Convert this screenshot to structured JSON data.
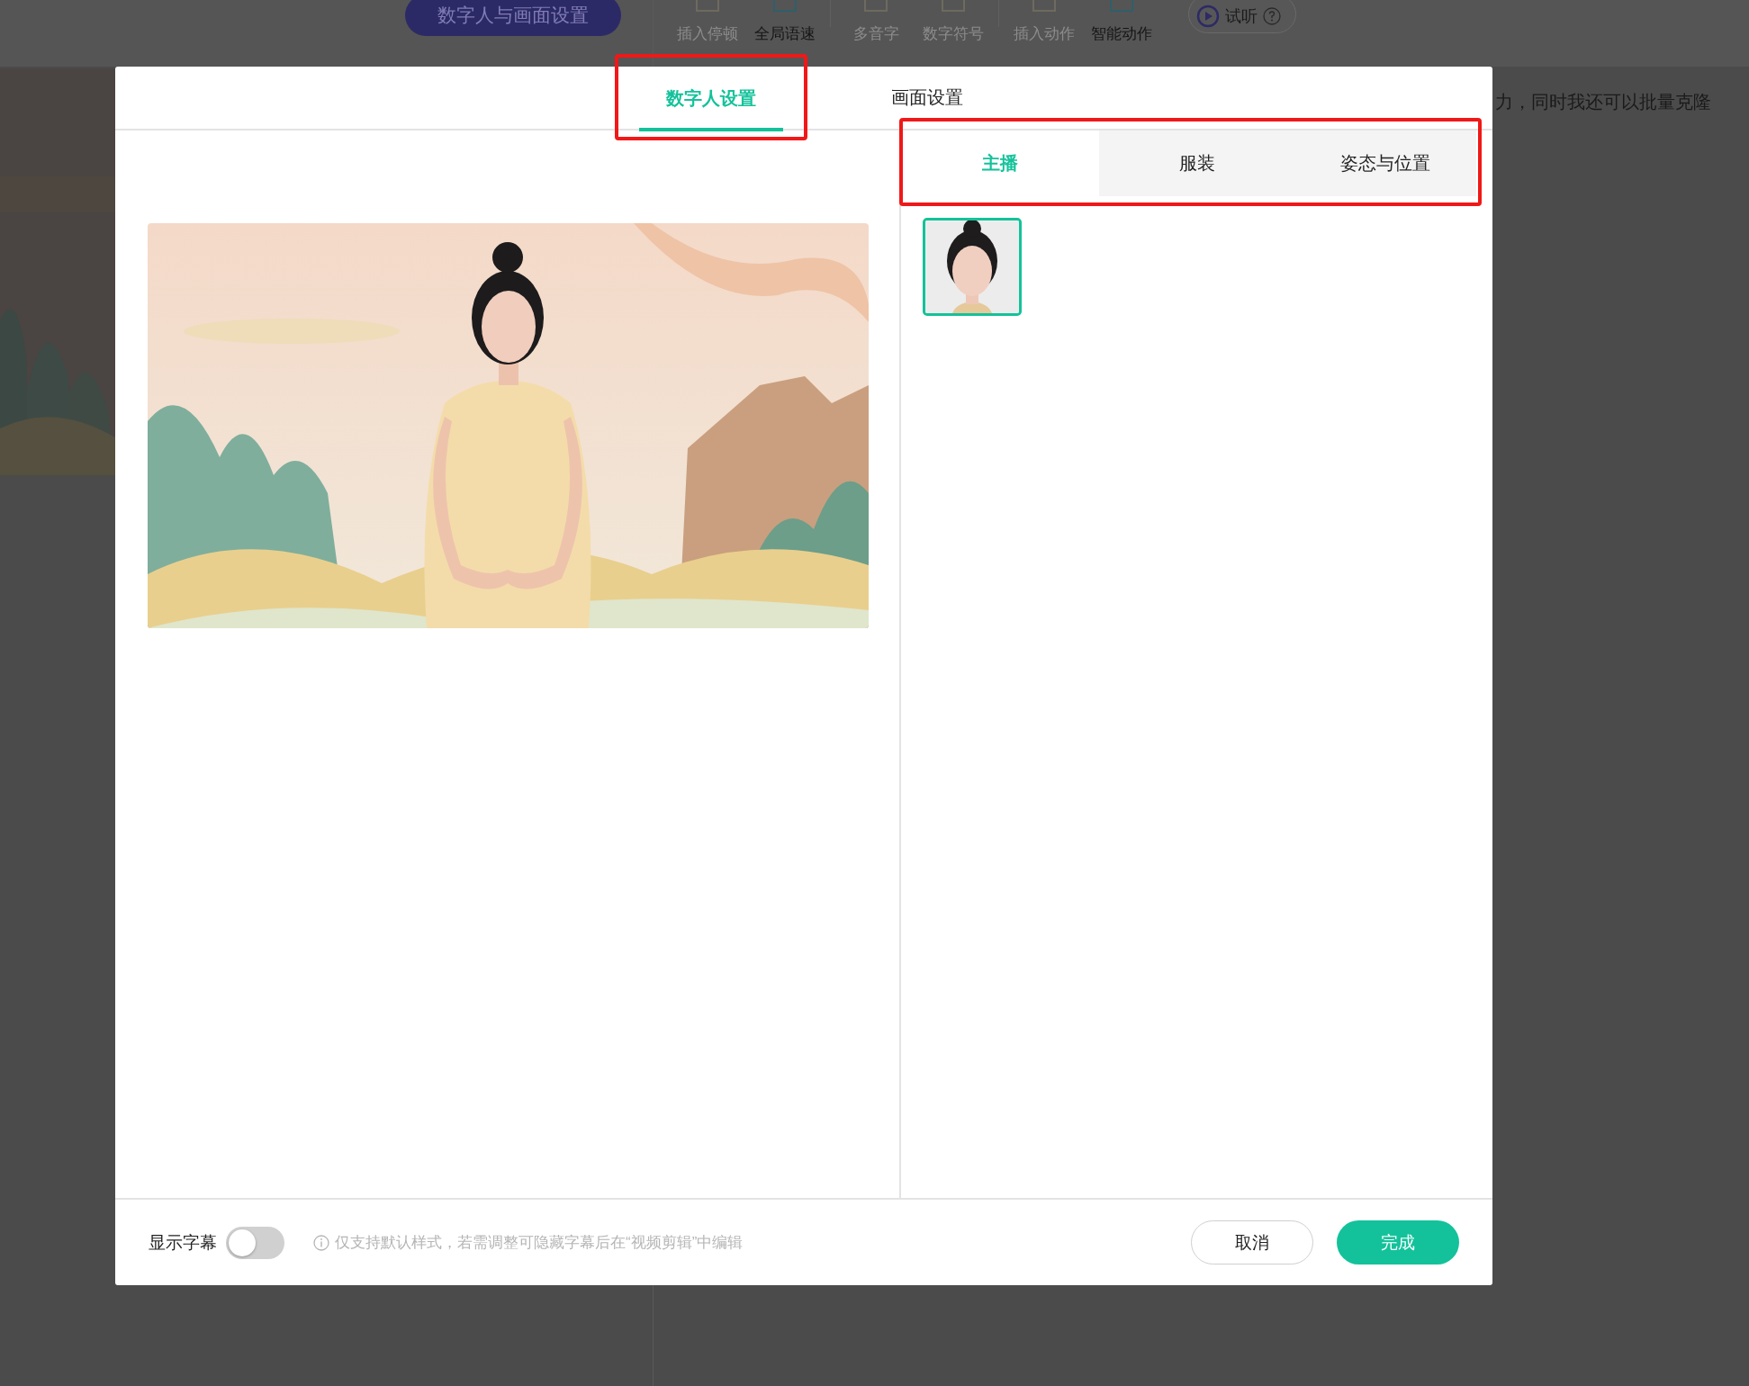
{
  "background": {
    "settings_button": "数字人与画面设置",
    "toolbar": [
      {
        "label": "插入停顿",
        "disabled": true
      },
      {
        "label": "全局语速",
        "disabled": false
      },
      {
        "label": "多音字",
        "disabled": true
      },
      {
        "label": "数字符号",
        "disabled": true
      },
      {
        "label": "插入动作",
        "disabled": true
      },
      {
        "label": "智能动作",
        "disabled": false
      }
    ],
    "listen_button": "试听",
    "body_text": "力，同时我还可以批量克隆"
  },
  "dialog": {
    "tabs": [
      {
        "label": "数字人设置",
        "selected": true,
        "highlighted": true
      },
      {
        "label": "画面设置",
        "selected": false,
        "highlighted": false
      }
    ],
    "subtab_bar": {
      "highlighted": true,
      "tabs": [
        {
          "label": "主播",
          "selected": true
        },
        {
          "label": "服装",
          "selected": false
        },
        {
          "label": "姿态与位置",
          "selected": false
        }
      ]
    },
    "avatars": [
      {
        "selected": true
      }
    ],
    "subtitles": {
      "label": "显示字幕",
      "on": false
    },
    "hint": "仅支持默认样式，若需调整可隐藏字幕后在“视频剪辑”中编辑",
    "buttons": [
      {
        "label": "取消",
        "kind": "secondary"
      },
      {
        "label": "完成",
        "kind": "primary"
      }
    ]
  }
}
